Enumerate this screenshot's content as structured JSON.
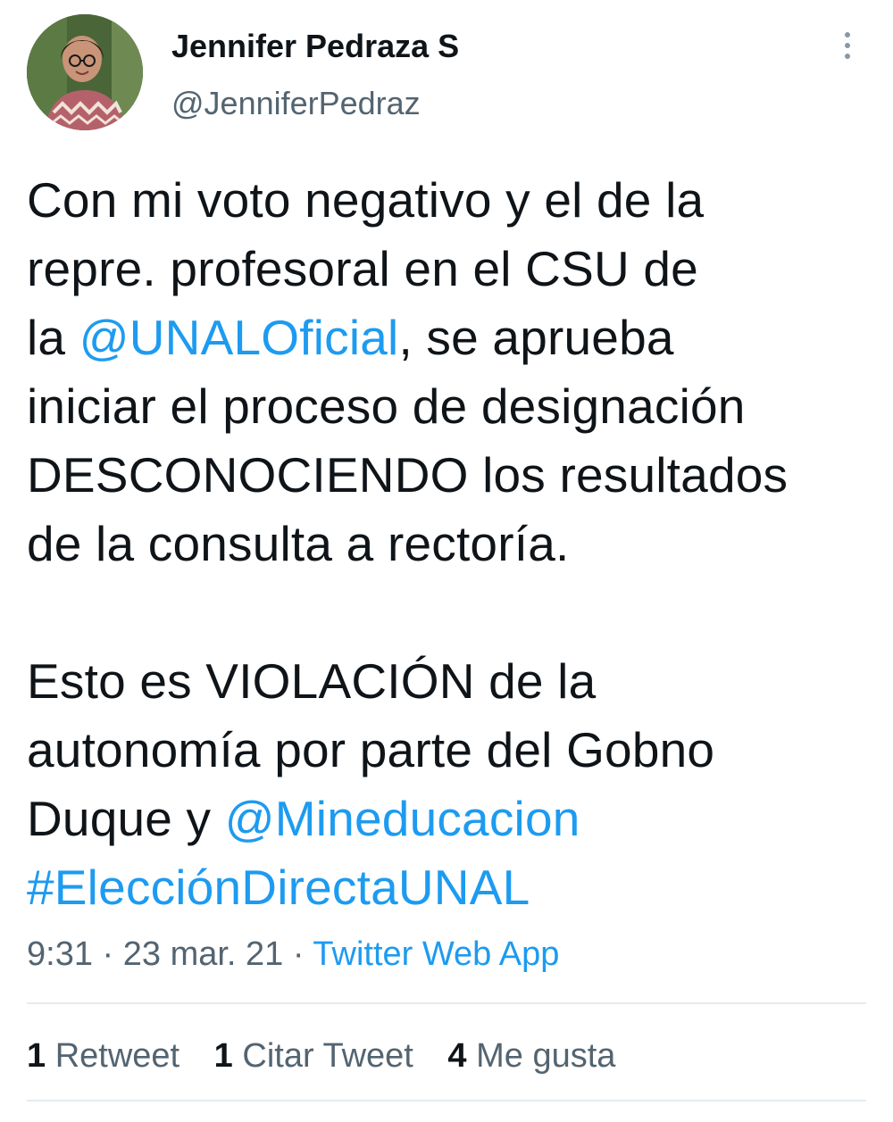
{
  "author": {
    "display_name": "Jennifer Pedraza S",
    "handle": "@JenniferPedraz"
  },
  "tweet": {
    "lines": [
      [
        {
          "text": "Con mi voto negativo y el de la"
        }
      ],
      [
        {
          "text": "repre. profesoral en el CSU de"
        }
      ],
      [
        {
          "text": "la "
        },
        {
          "text": "@UNALOficial",
          "link": true
        },
        {
          "text": ", se aprueba"
        }
      ],
      [
        {
          "text": "iniciar el proceso de designación"
        }
      ],
      [
        {
          "text": "DESCONOCIENDO los resultados"
        }
      ],
      [
        {
          "text": "de la consulta a rectoría."
        }
      ],
      [],
      [
        {
          "text": "Esto es VIOLACIÓN de la"
        }
      ],
      [
        {
          "text": "autonomía por parte del Gobno"
        }
      ],
      [
        {
          "text": "Duque  y "
        },
        {
          "text": "@Mineducacion",
          "link": true
        }
      ],
      [
        {
          "text": "#ElecciónDirectaUNAL",
          "link": true
        }
      ]
    ]
  },
  "meta": {
    "time": "9:31",
    "sep1": " · ",
    "date": "23 mar. 21",
    "sep2": " · ",
    "source": "Twitter Web App"
  },
  "stats": [
    {
      "count": "1",
      "label": "Retweet"
    },
    {
      "count": "1",
      "label": "Citar Tweet"
    },
    {
      "count": "4",
      "label": "Me gusta"
    }
  ],
  "colors": {
    "link": "#1d9bf0",
    "secondary_text": "#536471",
    "primary_text": "#0f1419"
  },
  "icons": {
    "more": "more-vertical-icon"
  }
}
